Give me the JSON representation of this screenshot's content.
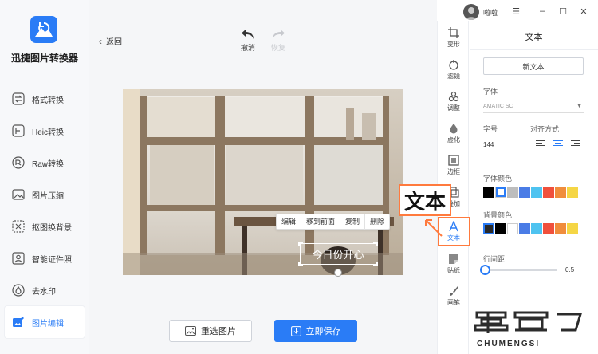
{
  "app": {
    "name": "迅捷图片转换器"
  },
  "sidebar": {
    "items": [
      {
        "label": "格式转换"
      },
      {
        "label": "Heic转换"
      },
      {
        "label": "Raw转换"
      },
      {
        "label": "图片压缩"
      },
      {
        "label": "抠图换背景"
      },
      {
        "label": "智能证件照"
      },
      {
        "label": "去水印"
      },
      {
        "label": "图片编辑",
        "active": true
      }
    ]
  },
  "header": {
    "back": "返回",
    "undo": "撤消",
    "redo": "恢复",
    "user": "啦啦"
  },
  "canvas": {
    "context_menu": [
      "编辑",
      "移到前面",
      "复制",
      "删除"
    ],
    "overlay_text": "今日份开心"
  },
  "footer": {
    "reselect": "重选图片",
    "save": "立即保存"
  },
  "tools": [
    {
      "label": "变形"
    },
    {
      "label": "滤镜"
    },
    {
      "label": "调整"
    },
    {
      "label": "虚化"
    },
    {
      "label": "边框"
    },
    {
      "label": "叠加"
    },
    {
      "label": "文本",
      "active": true
    },
    {
      "label": "贴纸"
    },
    {
      "label": "画笔"
    }
  ],
  "panel": {
    "title": "文本",
    "new_text": "新文本",
    "font_label": "字体",
    "font_value": "AMATIC SC",
    "size_label": "字号",
    "size_value": "144",
    "align_label": "对齐方式",
    "font_color_label": "字体颜色",
    "bg_color_label": "背景颜色",
    "line_spacing_label": "行间距",
    "line_spacing_value": "0.5",
    "font_colors": [
      "#000000",
      "#ffffff",
      "#bdbdbd",
      "#4a7ce6",
      "#4ec3f0",
      "#f0503c",
      "#f08d3c",
      "#f5d645"
    ],
    "bg_colors": [
      "#2a2a2a",
      "#000000",
      "#ffffff",
      "#4a7ce6",
      "#4ec3f0",
      "#f0503c",
      "#f08d3c",
      "#f5d645"
    ]
  },
  "annotation": {
    "label": "文本"
  },
  "watermark": {
    "text": "CHUMENGSI"
  },
  "colors": {
    "accent": "#2a7cf6",
    "highlight": "#ff7a3d"
  }
}
